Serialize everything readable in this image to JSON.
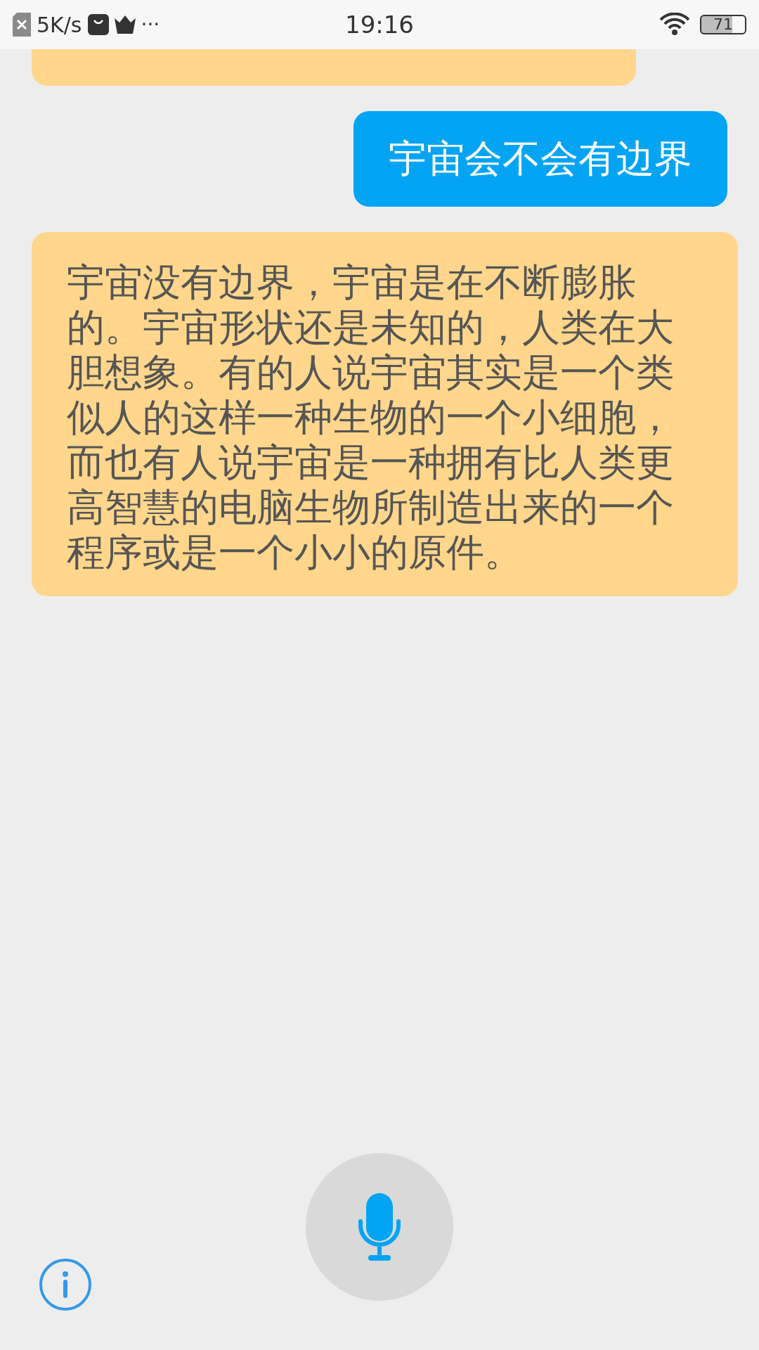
{
  "status_bar": {
    "net_speed": "5K/s",
    "more": "···",
    "time": "19:16",
    "battery": "71"
  },
  "messages": [
    {
      "kind": "user",
      "text": "宇宙会不会有边界"
    },
    {
      "kind": "bot",
      "text": "宇宙没有边界，宇宙是在不断膨胀的。宇宙形状还是未知的，人类在大胆想象。有的人说宇宙其实是一个类似人的这样一种生物的一个小细胞，而也有人说宇宙是一种拥有比人类更高智慧的电脑生物所制造出来的一个程序或是一个小小的原件。"
    }
  ]
}
